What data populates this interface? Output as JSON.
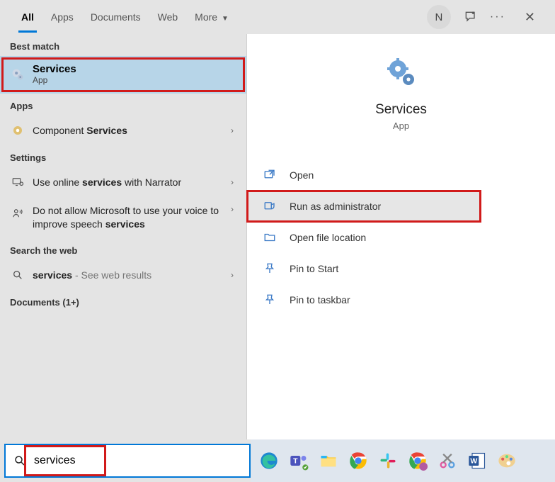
{
  "tabs": {
    "items": [
      "All",
      "Apps",
      "Documents",
      "Web",
      "More"
    ],
    "active_index": 0
  },
  "header": {
    "avatar_initial": "N"
  },
  "left": {
    "best_match_hdr": "Best match",
    "best_match": {
      "title": "Services",
      "subtitle": "App"
    },
    "apps_hdr": "Apps",
    "apps_item_prefix": "Component ",
    "apps_item_bold": "Services",
    "settings_hdr": "Settings",
    "setting1_pre": "Use online ",
    "setting1_bold": "services",
    "setting1_post": " with Narrator",
    "setting2_pre": "Do not allow Microsoft to use your voice to improve speech ",
    "setting2_bold": "services",
    "web_hdr": "Search the web",
    "web_item_bold": "services",
    "web_item_post": " - See web results",
    "docs_hdr": "Documents (1+)"
  },
  "right": {
    "title": "Services",
    "subtitle": "App",
    "actions": [
      {
        "label": "Open"
      },
      {
        "label": "Run as administrator"
      },
      {
        "label": "Open file location"
      },
      {
        "label": "Pin to Start"
      },
      {
        "label": "Pin to taskbar"
      }
    ]
  },
  "search": {
    "value": "services"
  },
  "taskbar": {
    "icons": [
      "edge",
      "teams",
      "explorer",
      "chrome",
      "slack",
      "chrome-beta",
      "snip",
      "word",
      "paint"
    ]
  }
}
